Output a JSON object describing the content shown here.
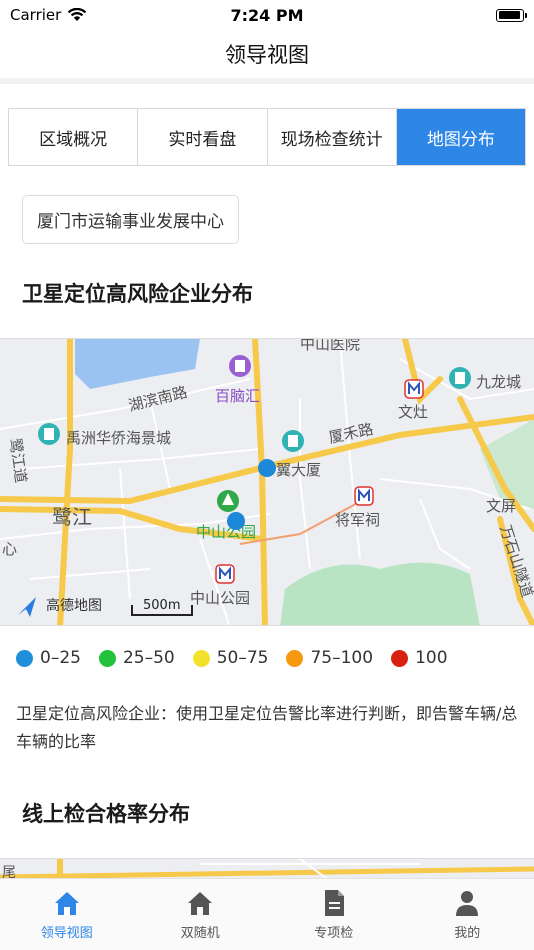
{
  "status_bar": {
    "carrier": "Carrier",
    "time": "7:24 PM"
  },
  "nav": {
    "title": "领导视图"
  },
  "tabs": [
    {
      "label": "区域概况",
      "active": false
    },
    {
      "label": "实时看盘",
      "active": false
    },
    {
      "label": "现场检查统计",
      "active": false
    },
    {
      "label": "地图分布",
      "active": true
    }
  ],
  "org": {
    "name": "厦门市运输事业发展中心"
  },
  "section1": {
    "title": "卫星定位高风险企业分布"
  },
  "map": {
    "labels": {
      "hospital": "中山医院",
      "bainaohui": "百脑汇",
      "hubin_road": "湖滨南路",
      "jiulong": "九龙城",
      "yuzhou": "禹洲华侨海景城",
      "heshe_road": "厦禾路",
      "wenzao": "文灶",
      "xiada": "翼大厦",
      "lujiang": "鹭江",
      "jiangjunci": "将军祠",
      "wenping": "文屏",
      "zhongshan_park_poi": "中山公园",
      "zhongshan_park_metro": "中山公园",
      "wanshishan": "万石山隧道",
      "lujiang_road": "鹭江道",
      "xin": "心",
      "wei": "尾"
    },
    "logo": "高德地图",
    "scale": "500m",
    "markers": [
      {
        "color": "#1e88d8"
      },
      {
        "color": "#1e88d8"
      }
    ]
  },
  "legend": [
    {
      "label": "0–25",
      "color": "#1e8fd8"
    },
    {
      "label": "25–50",
      "color": "#22c23a"
    },
    {
      "label": "50–75",
      "color": "#f3e12b"
    },
    {
      "label": "75–100",
      "color": "#f7990f"
    },
    {
      "label": "100",
      "color": "#d8220f"
    }
  ],
  "description": "卫星定位高风险企业：使用卫星定位告警比率进行判断，即告警车辆/总车辆的比率",
  "section2": {
    "title": "线上检合格率分布"
  },
  "tab_bar": [
    {
      "label": "领导视图",
      "icon": "home-icon",
      "active": true
    },
    {
      "label": "双随机",
      "icon": "home-icon",
      "active": false
    },
    {
      "label": "专项检",
      "icon": "document-icon",
      "active": false
    },
    {
      "label": "我的",
      "icon": "user-icon",
      "active": false
    }
  ]
}
